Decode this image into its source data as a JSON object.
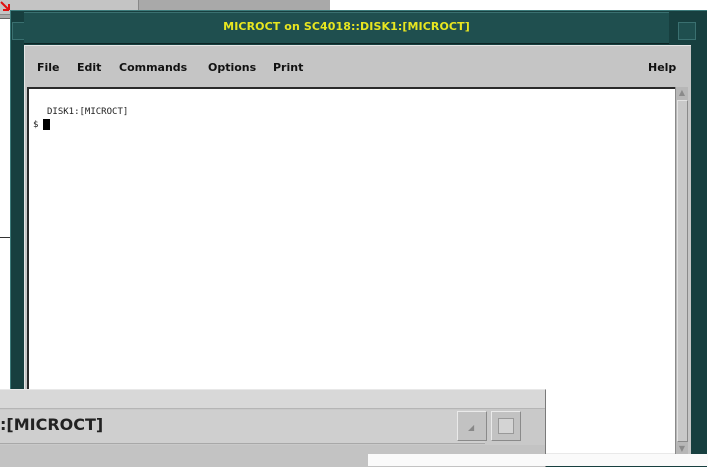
{
  "window": {
    "title": "MICROCT on SC4018::DISK1:[MICROCT]"
  },
  "menubar": {
    "file": "File",
    "edit": "Edit",
    "commands": "Commands",
    "options": "Options",
    "print": "Print",
    "help": "Help"
  },
  "terminal": {
    "lines": [
      "DISK1:[MICROCT]",
      "$"
    ]
  },
  "overlay": {
    "path_text": ":[MICROCT]"
  },
  "colors": {
    "frame": "#173f3f",
    "title_text": "#e8e620",
    "client": "#c5c5c5",
    "terminal_bg": "#ffffff",
    "accent_red": "#e01010"
  },
  "icons": {
    "red_arrow": "red-arrow-icon",
    "scroll_up": "scroll-up-arrow-icon",
    "scroll_down": "scroll-down-arrow-icon",
    "resize": "resize-icon",
    "maximize": "maximize-square-icon"
  }
}
